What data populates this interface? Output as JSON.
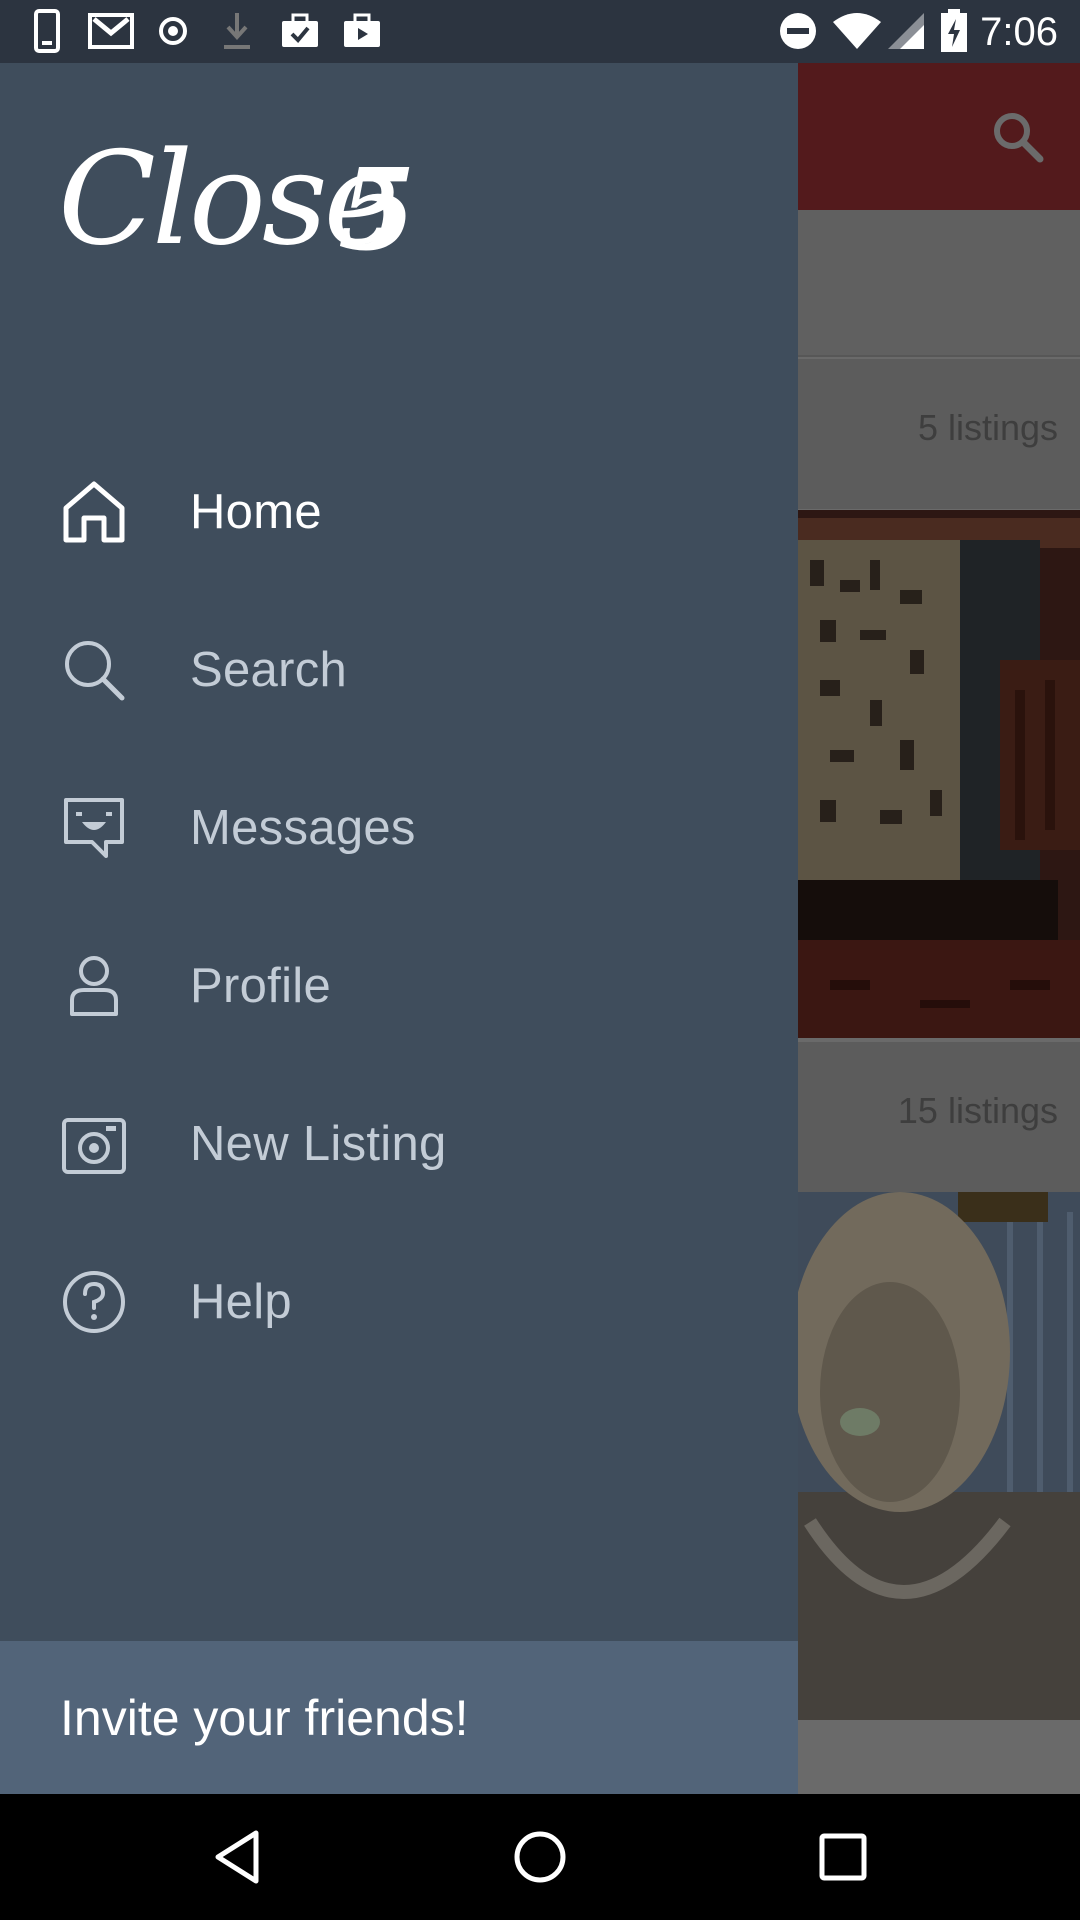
{
  "status_bar": {
    "time": "7:06",
    "left_icons": [
      "phone-icon",
      "gmail-icon",
      "record-icon",
      "download-icon",
      "briefcase-check-icon",
      "briefcase-icon"
    ],
    "right_icons": [
      "do-not-disturb-icon",
      "wifi-icon",
      "cell-signal-icon",
      "battery-charging-icon"
    ]
  },
  "background_app": {
    "toolbar_color": "#b22a2e",
    "search_icon": "search-icon",
    "categories": [
      {
        "count": "5 listings"
      },
      {
        "count": "15 listings"
      }
    ]
  },
  "drawer": {
    "logo_text": "Close5",
    "items": [
      {
        "label": "Home",
        "icon": "home-icon",
        "active": true
      },
      {
        "label": "Search",
        "icon": "search-icon",
        "active": false
      },
      {
        "label": "Messages",
        "icon": "messages-icon",
        "active": false
      },
      {
        "label": "Profile",
        "icon": "profile-icon",
        "active": false
      },
      {
        "label": "New Listing",
        "icon": "camera-icon",
        "active": false
      },
      {
        "label": "Help",
        "icon": "help-icon",
        "active": false
      }
    ],
    "invite_label": "Invite your friends!"
  },
  "nav_bar": {
    "buttons": [
      "back-icon",
      "home-circle-icon",
      "recents-icon"
    ]
  },
  "colors": {
    "drawer_bg": "#3f4d5c",
    "invite_bg": "#526479",
    "status_bar_bg": "#2c3440"
  }
}
